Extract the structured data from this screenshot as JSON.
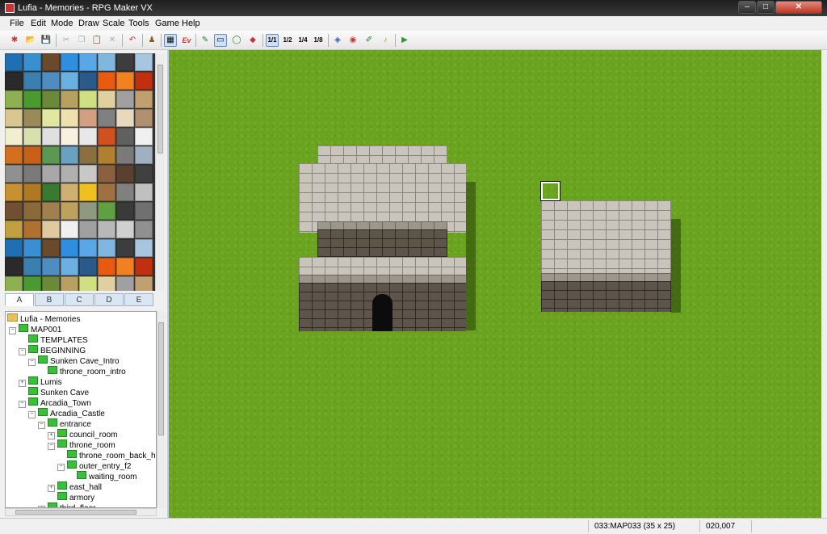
{
  "window": {
    "title": "Lufia - Memories - RPG Maker VX"
  },
  "menu": [
    "File",
    "Edit",
    "Mode",
    "Draw",
    "Scale",
    "Tools",
    "Game",
    "Help"
  ],
  "toolbar": {
    "buttons": [
      {
        "name": "new-project-icon",
        "glyph": "✱"
      },
      {
        "name": "open-project-icon",
        "glyph": "📂"
      },
      {
        "name": "save-icon",
        "glyph": "💾"
      },
      {
        "name": "cut-icon",
        "glyph": "✂"
      },
      {
        "name": "copy-icon",
        "glyph": "❐"
      },
      {
        "name": "paste-icon",
        "glyph": "📋"
      },
      {
        "name": "delete-icon",
        "glyph": "✕"
      },
      {
        "name": "undo-icon",
        "glyph": "↶"
      },
      {
        "name": "map-mode-icon",
        "glyph": "♟"
      },
      {
        "name": "tile-layer-icon",
        "glyph": "▦"
      },
      {
        "name": "event-layer-icon",
        "glyph": "Ev"
      },
      {
        "name": "pencil-icon",
        "glyph": "✎"
      },
      {
        "name": "rectangle-icon",
        "glyph": "▭"
      },
      {
        "name": "ellipse-icon",
        "glyph": "◯"
      },
      {
        "name": "fill-icon",
        "glyph": "◆"
      },
      {
        "name": "scale-1-1-icon",
        "glyph": "1/1"
      },
      {
        "name": "scale-1-2-icon",
        "glyph": "1/2"
      },
      {
        "name": "scale-1-4-icon",
        "glyph": "1/4"
      },
      {
        "name": "scale-1-8-icon",
        "glyph": "1/8"
      },
      {
        "name": "database-icon",
        "glyph": "◈"
      },
      {
        "name": "resource-manager-icon",
        "glyph": "◉"
      },
      {
        "name": "script-editor-icon",
        "glyph": "✐"
      },
      {
        "name": "sound-test-icon",
        "glyph": "♪"
      },
      {
        "name": "playtest-icon",
        "glyph": "▶"
      }
    ]
  },
  "tileset_tabs": [
    "A",
    "B",
    "C",
    "D",
    "E"
  ],
  "tree": {
    "project": "Lufia - Memories",
    "items": [
      {
        "label": "MAP001",
        "depth": 0,
        "exp": "−"
      },
      {
        "label": "TEMPLATES",
        "depth": 1,
        "exp": ""
      },
      {
        "label": "BEGINNING",
        "depth": 1,
        "exp": "−"
      },
      {
        "label": "Sunken Cave_Intro",
        "depth": 2,
        "exp": "−"
      },
      {
        "label": "throne_room_intro",
        "depth": 3,
        "exp": ""
      },
      {
        "label": "Lumis",
        "depth": 1,
        "exp": "+"
      },
      {
        "label": "Sunken Cave",
        "depth": 1,
        "exp": ""
      },
      {
        "label": "Arcadia_Town",
        "depth": 1,
        "exp": "−"
      },
      {
        "label": "Arcadia_Castle",
        "depth": 2,
        "exp": "−"
      },
      {
        "label": "entrance",
        "depth": 3,
        "exp": "−"
      },
      {
        "label": "council_room",
        "depth": 4,
        "exp": "+"
      },
      {
        "label": "throne_room",
        "depth": 4,
        "exp": "−"
      },
      {
        "label": "throne_room_back_ha",
        "depth": 5,
        "exp": ""
      },
      {
        "label": "outer_entry_f2",
        "depth": 5,
        "exp": "−"
      },
      {
        "label": "waiting_room",
        "depth": 6,
        "exp": ""
      },
      {
        "label": "east_hall",
        "depth": 4,
        "exp": "+"
      },
      {
        "label": "armory",
        "depth": 4,
        "exp": ""
      },
      {
        "label": "third_floor",
        "depth": 3,
        "exp": "+"
      }
    ]
  },
  "status": {
    "map_info": "033:MAP033 (35 x 25)",
    "coords": "020,007"
  },
  "colors": {
    "grass": "#6aa41f",
    "stone_top": "#c9c5bc",
    "stone_face": "#5d5549"
  }
}
